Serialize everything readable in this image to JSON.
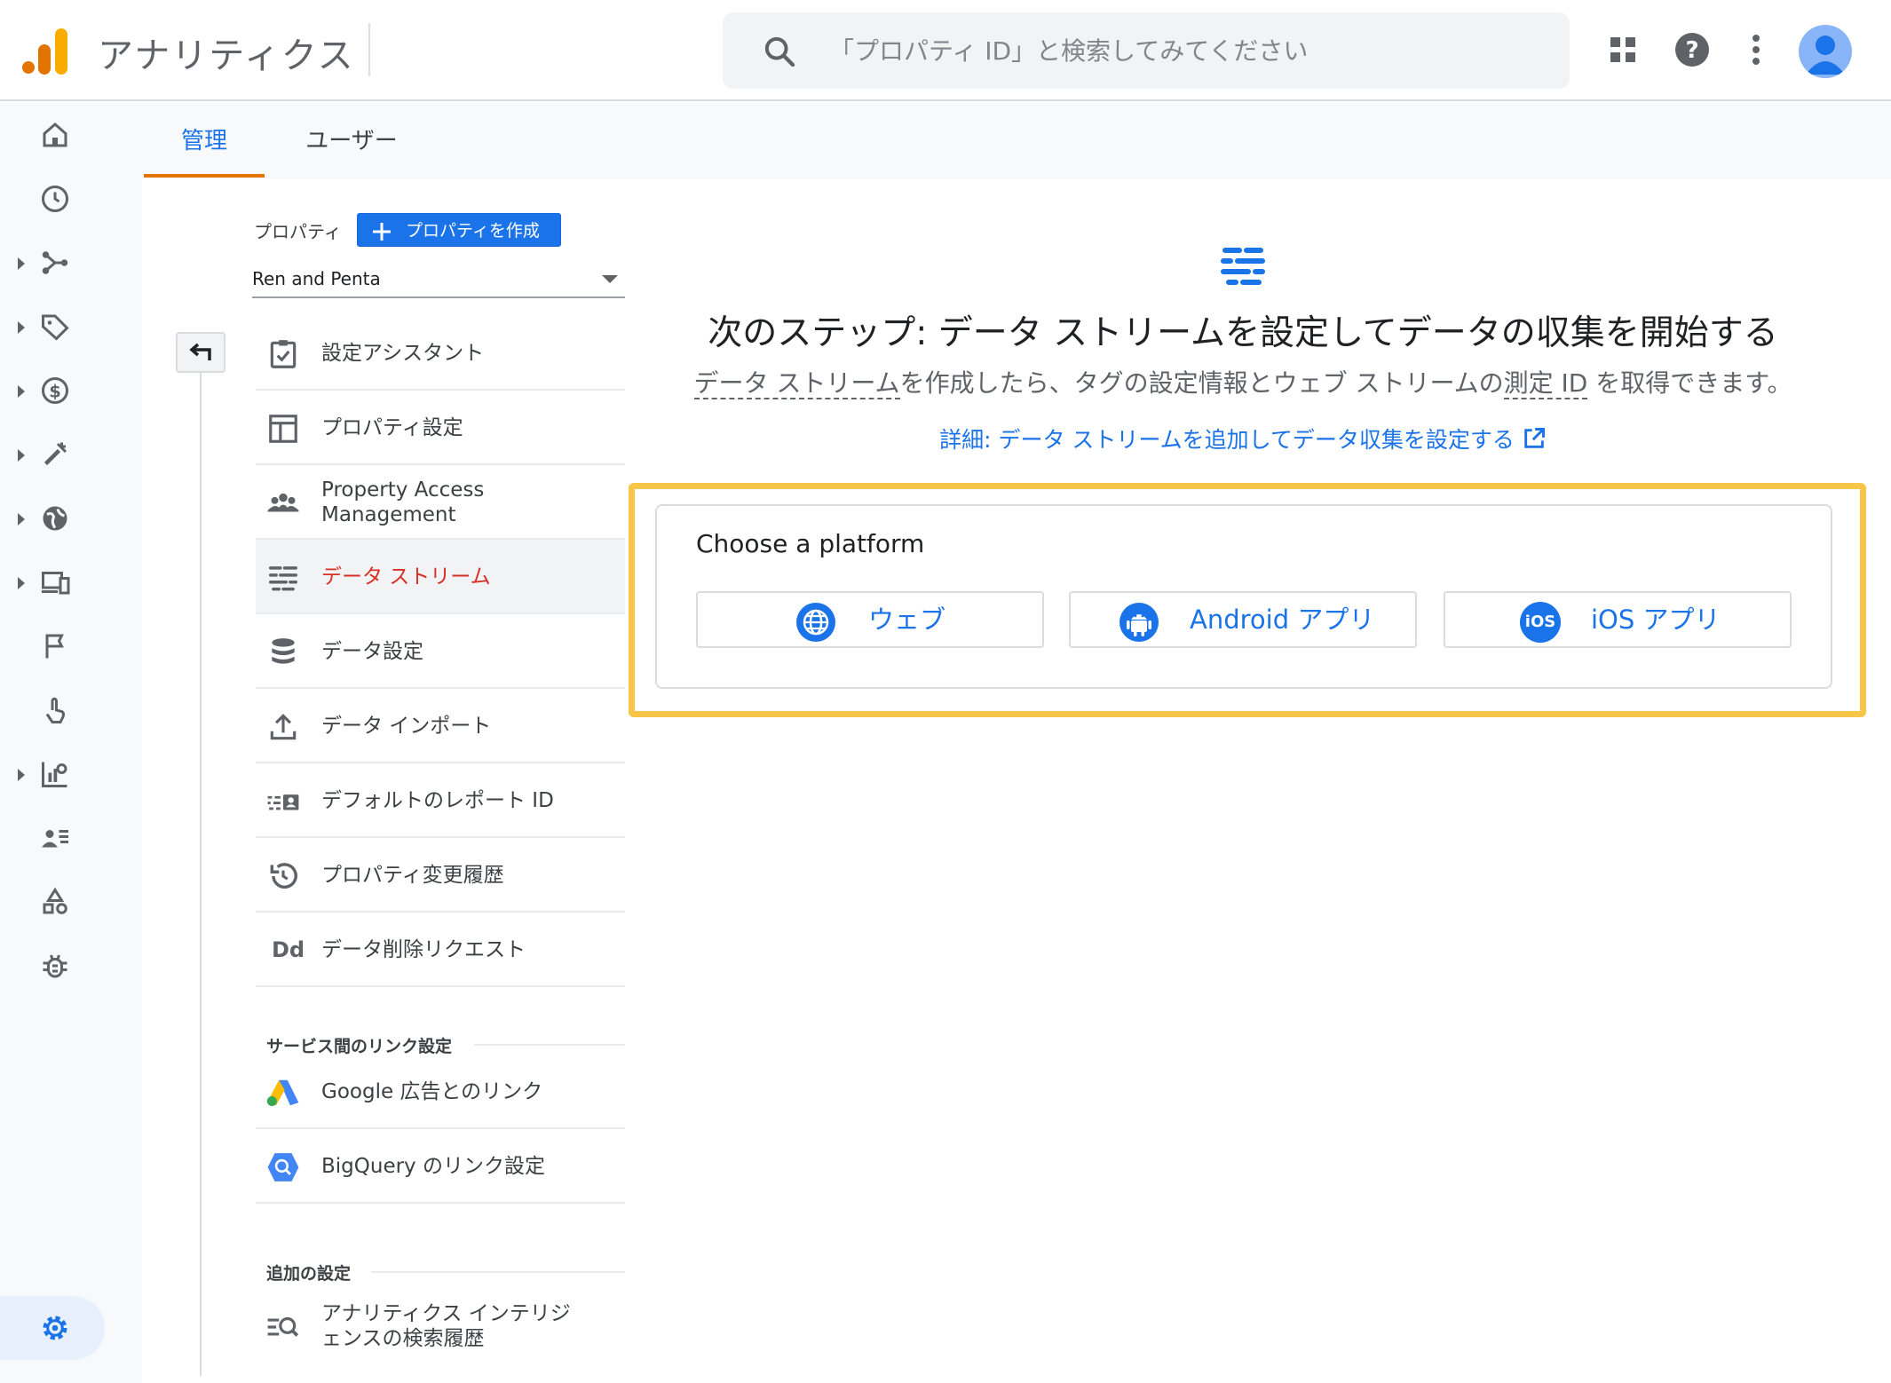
{
  "header": {
    "app_title": "アナリティクス",
    "search_placeholder": "「プロパティ ID」と検索してみてください",
    "icons": [
      "apps-icon",
      "help-icon",
      "more-vert-icon",
      "account-avatar"
    ]
  },
  "rail": {
    "items": [
      "home-icon",
      "reports-icon",
      "explore-icon",
      "tag-icon",
      "monetization-icon",
      "magic-wand-icon",
      "globe-icon",
      "devices-icon",
      "flag-icon",
      "touch-icon",
      "insights-icon",
      "audience-icon",
      "shapes-icon",
      "debug-icon"
    ],
    "admin": "settings-icon"
  },
  "tabs": [
    {
      "label": "管理",
      "active": true
    },
    {
      "label": "ユーザー",
      "active": false
    }
  ],
  "property": {
    "label": "プロパティ",
    "create_button": "プロパティを作成",
    "selected": "Ren and Penta"
  },
  "menu": [
    {
      "label": "設定アシスタント",
      "icon": "checklist-icon"
    },
    {
      "label": "プロパティ設定",
      "icon": "layout-icon"
    },
    {
      "label": "Property Access Management",
      "icon": "people-icon"
    },
    {
      "label": "データ ストリーム",
      "icon": "data-stream-icon",
      "selected": true
    },
    {
      "label": "データ設定",
      "icon": "database-icon"
    },
    {
      "label": "データ インポート",
      "icon": "upload-icon"
    },
    {
      "label": "デフォルトのレポート ID",
      "icon": "report-id-icon"
    },
    {
      "label": "プロパティ変更履歴",
      "icon": "history-icon"
    },
    {
      "label": "データ削除リクエスト",
      "icon": "dd-icon",
      "icon_text": "Dd"
    }
  ],
  "links_section": {
    "title": "サービス間のリンク設定",
    "items": [
      {
        "label": "Google 広告とのリンク",
        "icon": "google-ads-icon"
      },
      {
        "label": "BigQuery のリンク設定",
        "icon": "bigquery-icon"
      }
    ]
  },
  "additional_section": {
    "title": "追加の設定",
    "items": [
      {
        "label": "アナリティクス インテリジェンスの検索履歴",
        "line1": "アナリティクス インテリジ",
        "line2": "ェンスの検索履歴",
        "icon": "search-history-icon"
      }
    ]
  },
  "main": {
    "title": "次のステップ: データ ストリームを設定してデータの収集を開始する",
    "subtitle_parts": [
      "データ ストリーム",
      "を作成したら、タグの設定情報とウェブ ストリームの",
      "測定 ID",
      " を取得できます。"
    ],
    "link": "詳細: データ ストリームを追加してデータ収集を設定する",
    "platform_heading": "Choose a platform",
    "platforms": [
      {
        "label": "ウェブ",
        "icon": "web-globe-icon"
      },
      {
        "label": "Android アプリ",
        "icon": "android-icon"
      },
      {
        "label": "iOS アプリ",
        "icon": "ios-icon",
        "icon_text": "iOS"
      }
    ]
  },
  "colors": {
    "accent": "#1a73e8",
    "selected": "#d93025",
    "highlight": "#f9c548",
    "tab_indicator": "#e37400"
  }
}
